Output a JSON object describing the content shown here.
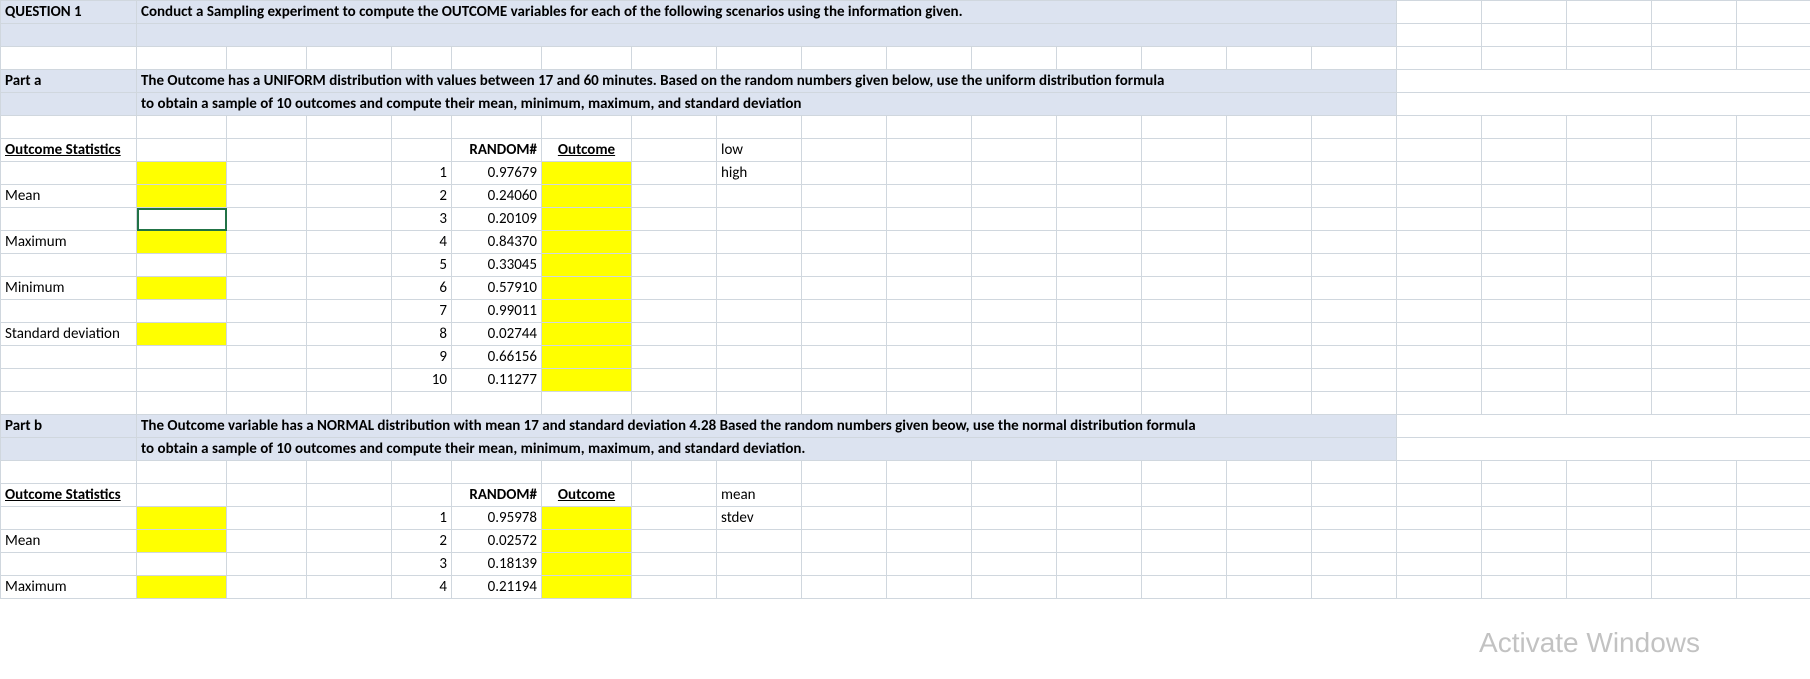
{
  "question": {
    "label": "QUESTION 1",
    "text": "Conduct a Sampling experiment to compute the OUTCOME variables for each of the following scenarios using the information given."
  },
  "partA": {
    "label": "Part a",
    "line1": "The Outcome has a UNIFORM distribution  with values between 17 and 60 minutes.  Based on the random numbers given below,  use the uniform distribution formula",
    "line2": " to obtain a sample of 10 outcomes and compute their mean, minimum, maximum, and standard deviation",
    "stats_header": "Outcome Statistics",
    "stats": {
      "mean": "Mean",
      "max": "Maximum",
      "min": "Minimum",
      "std": "Standard deviation"
    },
    "col_random": "RANDOM#",
    "col_outcome": "Outcome",
    "params": {
      "low": "low",
      "high": "high"
    },
    "rows": [
      {
        "n": "1",
        "rand": "0.97679"
      },
      {
        "n": "2",
        "rand": "0.24060"
      },
      {
        "n": "3",
        "rand": "0.20109"
      },
      {
        "n": "4",
        "rand": "0.84370"
      },
      {
        "n": "5",
        "rand": "0.33045"
      },
      {
        "n": "6",
        "rand": "0.57910"
      },
      {
        "n": "7",
        "rand": "0.99011"
      },
      {
        "n": "8",
        "rand": "0.02744"
      },
      {
        "n": "9",
        "rand": "0.66156"
      },
      {
        "n": "10",
        "rand": "0.11277"
      }
    ]
  },
  "partB": {
    "label": "Part b",
    "line1": "The Outcome variable has a NORMAL distribution  with mean 17 and standard deviation 4.28  Based the random numbers given beow, use the normal distribution formula",
    "line2": " to obtain a sample of 10 outcomes and compute their mean, minimum, maximum, and standard deviation.",
    "stats_header": "Outcome Statistics",
    "stats": {
      "mean": "Mean",
      "max": "Maximum"
    },
    "col_random": "RANDOM#",
    "col_outcome": "Outcome",
    "params": {
      "mean": "mean",
      "stdev": "stdev"
    },
    "rows": [
      {
        "n": "1",
        "rand": "0.95978"
      },
      {
        "n": "2",
        "rand": "0.02572"
      },
      {
        "n": "3",
        "rand": "0.18139"
      },
      {
        "n": "4",
        "rand": "0.21194"
      }
    ]
  },
  "watermark": "Activate Windows"
}
